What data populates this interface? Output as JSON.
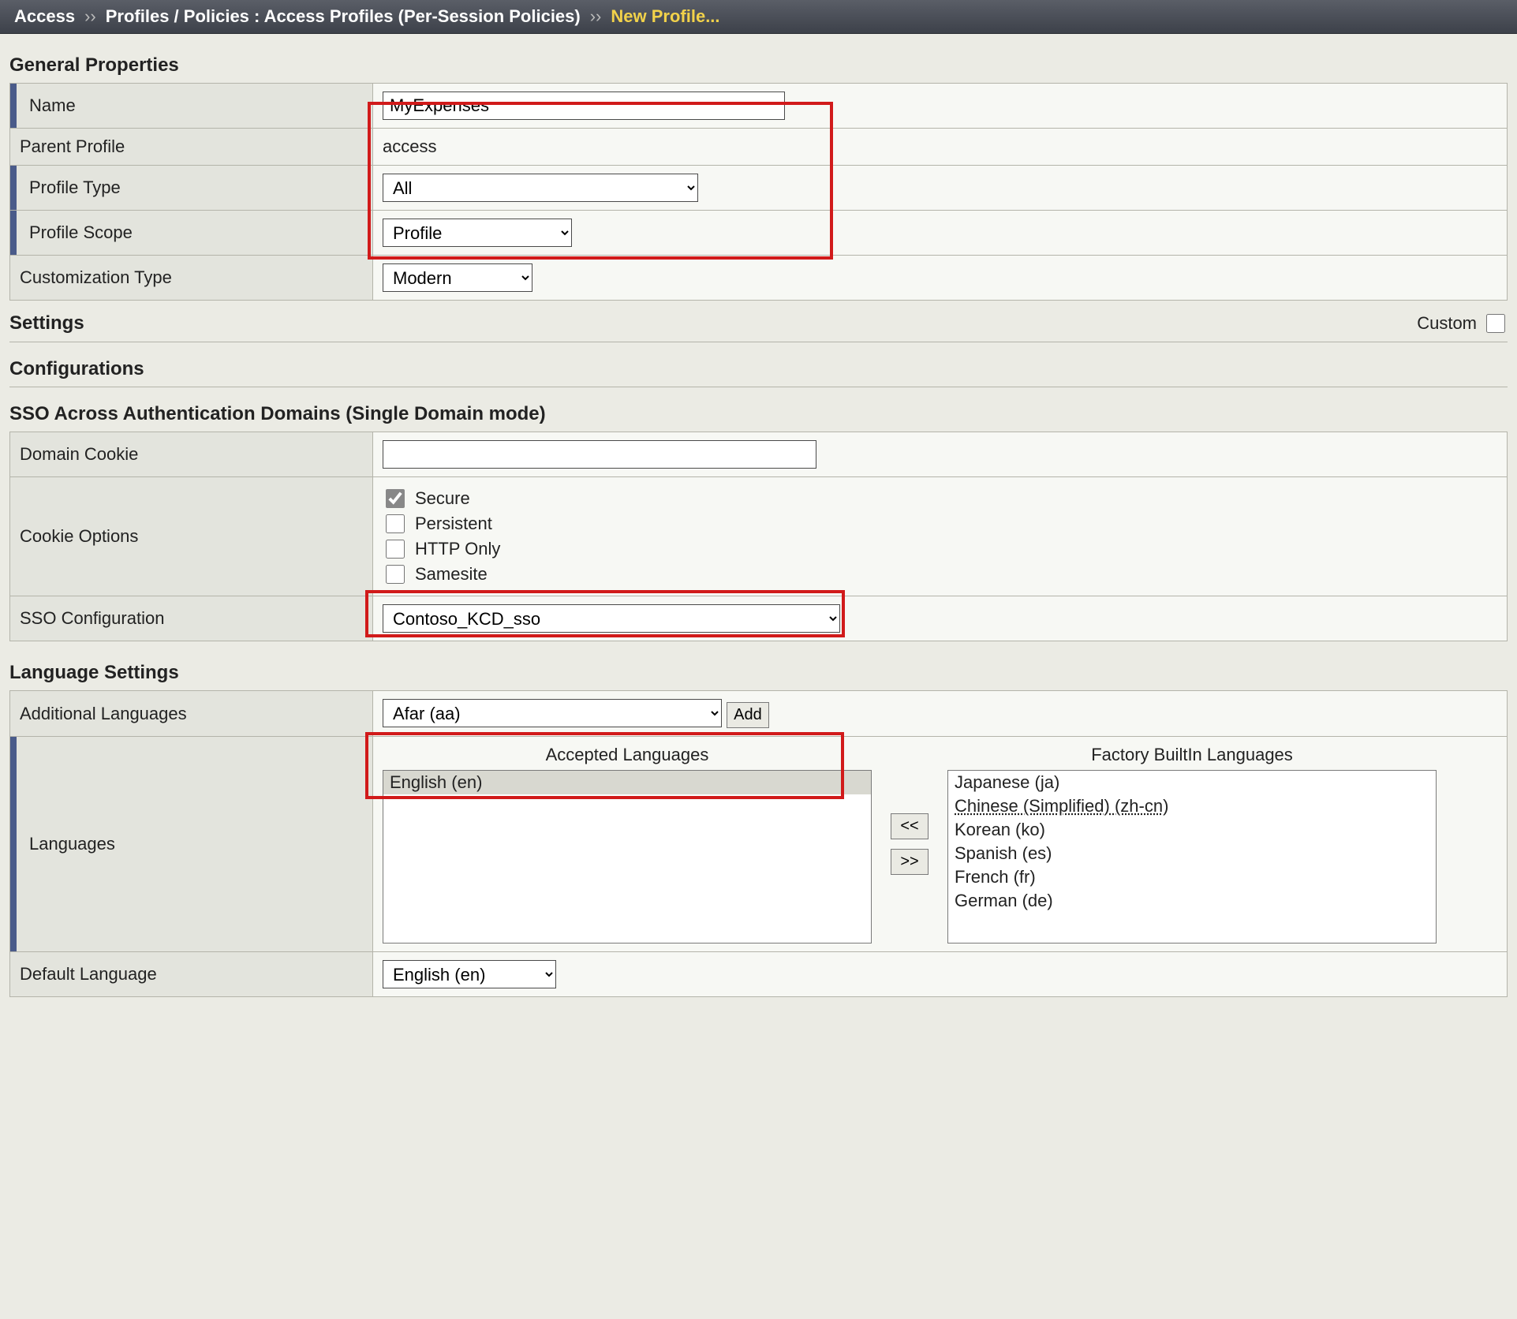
{
  "breadcrumb": {
    "part1": "Access",
    "sep1": "››",
    "part2": "Profiles / Policies : Access Profiles (Per-Session Policies)",
    "sep2": "››",
    "current": "New Profile..."
  },
  "sections": {
    "general": "General Properties",
    "settings": "Settings",
    "configurations": "Configurations",
    "sso_domains": "SSO Across Authentication Domains (Single Domain mode)",
    "language": "Language Settings"
  },
  "general": {
    "name_label": "Name",
    "name_value": "MyExpenses",
    "parent_label": "Parent Profile",
    "parent_value": "access",
    "profile_type_label": "Profile Type",
    "profile_type_value": "All",
    "profile_scope_label": "Profile Scope",
    "profile_scope_value": "Profile",
    "customization_type_label": "Customization Type",
    "customization_type_value": "Modern"
  },
  "settings": {
    "custom_label": "Custom"
  },
  "sso": {
    "domain_cookie_label": "Domain Cookie",
    "domain_cookie_value": "",
    "cookie_options_label": "Cookie Options",
    "secure_label": "Secure",
    "persistent_label": "Persistent",
    "http_only_label": "HTTP Only",
    "samesite_label": "Samesite",
    "sso_config_label": "SSO Configuration",
    "sso_config_value": "Contoso_KCD_sso",
    "cookie_options_state": {
      "secure": true,
      "persistent": false,
      "http_only": false,
      "samesite": false
    }
  },
  "language": {
    "additional_label": "Additional Languages",
    "additional_value": "Afar (aa)",
    "add_button": "Add",
    "languages_label": "Languages",
    "accepted_header": "Accepted Languages",
    "factory_header": "Factory BuiltIn Languages",
    "move_left": "<<",
    "move_right": ">>",
    "default_label": "Default Language",
    "default_value": "English (en)",
    "accepted_list": [
      "English (en)"
    ],
    "factory_list": [
      "Japanese (ja)",
      "Chinese (Simplified) (zh-cn)",
      "Korean (ko)",
      "Spanish (es)",
      "French (fr)",
      "German (de)"
    ]
  }
}
